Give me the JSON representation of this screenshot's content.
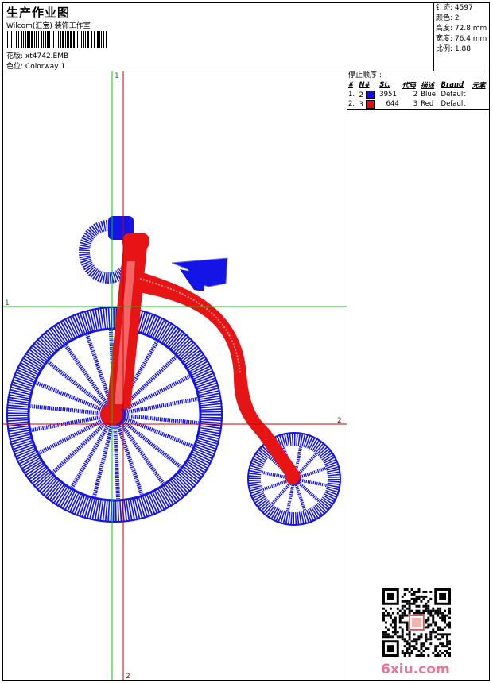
{
  "header": {
    "title": "生产作业图",
    "subtitle": "Wilcom(汇宝) 装饰工作室",
    "design_label": "花版:",
    "design_value": "xt4742.EMB",
    "colorway_label": "色位:",
    "colorway_value": "Colorway 1"
  },
  "stats": {
    "stitches": "针迹: 4597",
    "colors": "颜色: 2",
    "height": "高度: 72.8 mm",
    "width": "宽度: 76.4 mm",
    "scale": "比例: 1.88"
  },
  "stop_sequence": {
    "title": "停止顺序 :",
    "columns": [
      "#",
      "N#",
      "St.",
      "代码",
      "描述",
      "Brand",
      "元素"
    ],
    "rows": [
      {
        "idx": "1.",
        "n": "2",
        "color": "#1010e0",
        "st": "3951",
        "code": "2",
        "desc": "Blue",
        "brand": "Default"
      },
      {
        "idx": "2.",
        "n": "3",
        "color": "#e01010",
        "st": "644",
        "code": "3",
        "desc": "Red",
        "brand": "Default"
      }
    ]
  },
  "guides": {
    "green_top_label": "1",
    "green_left_label": "1",
    "red_right_label": "2",
    "red_bottom_label": "2"
  },
  "colors": {
    "blue": "#1414e6",
    "red": "#e61414",
    "guide_green": "#00cc00",
    "guide_red": "#cc0000"
  },
  "watermark": "6xiu.com"
}
